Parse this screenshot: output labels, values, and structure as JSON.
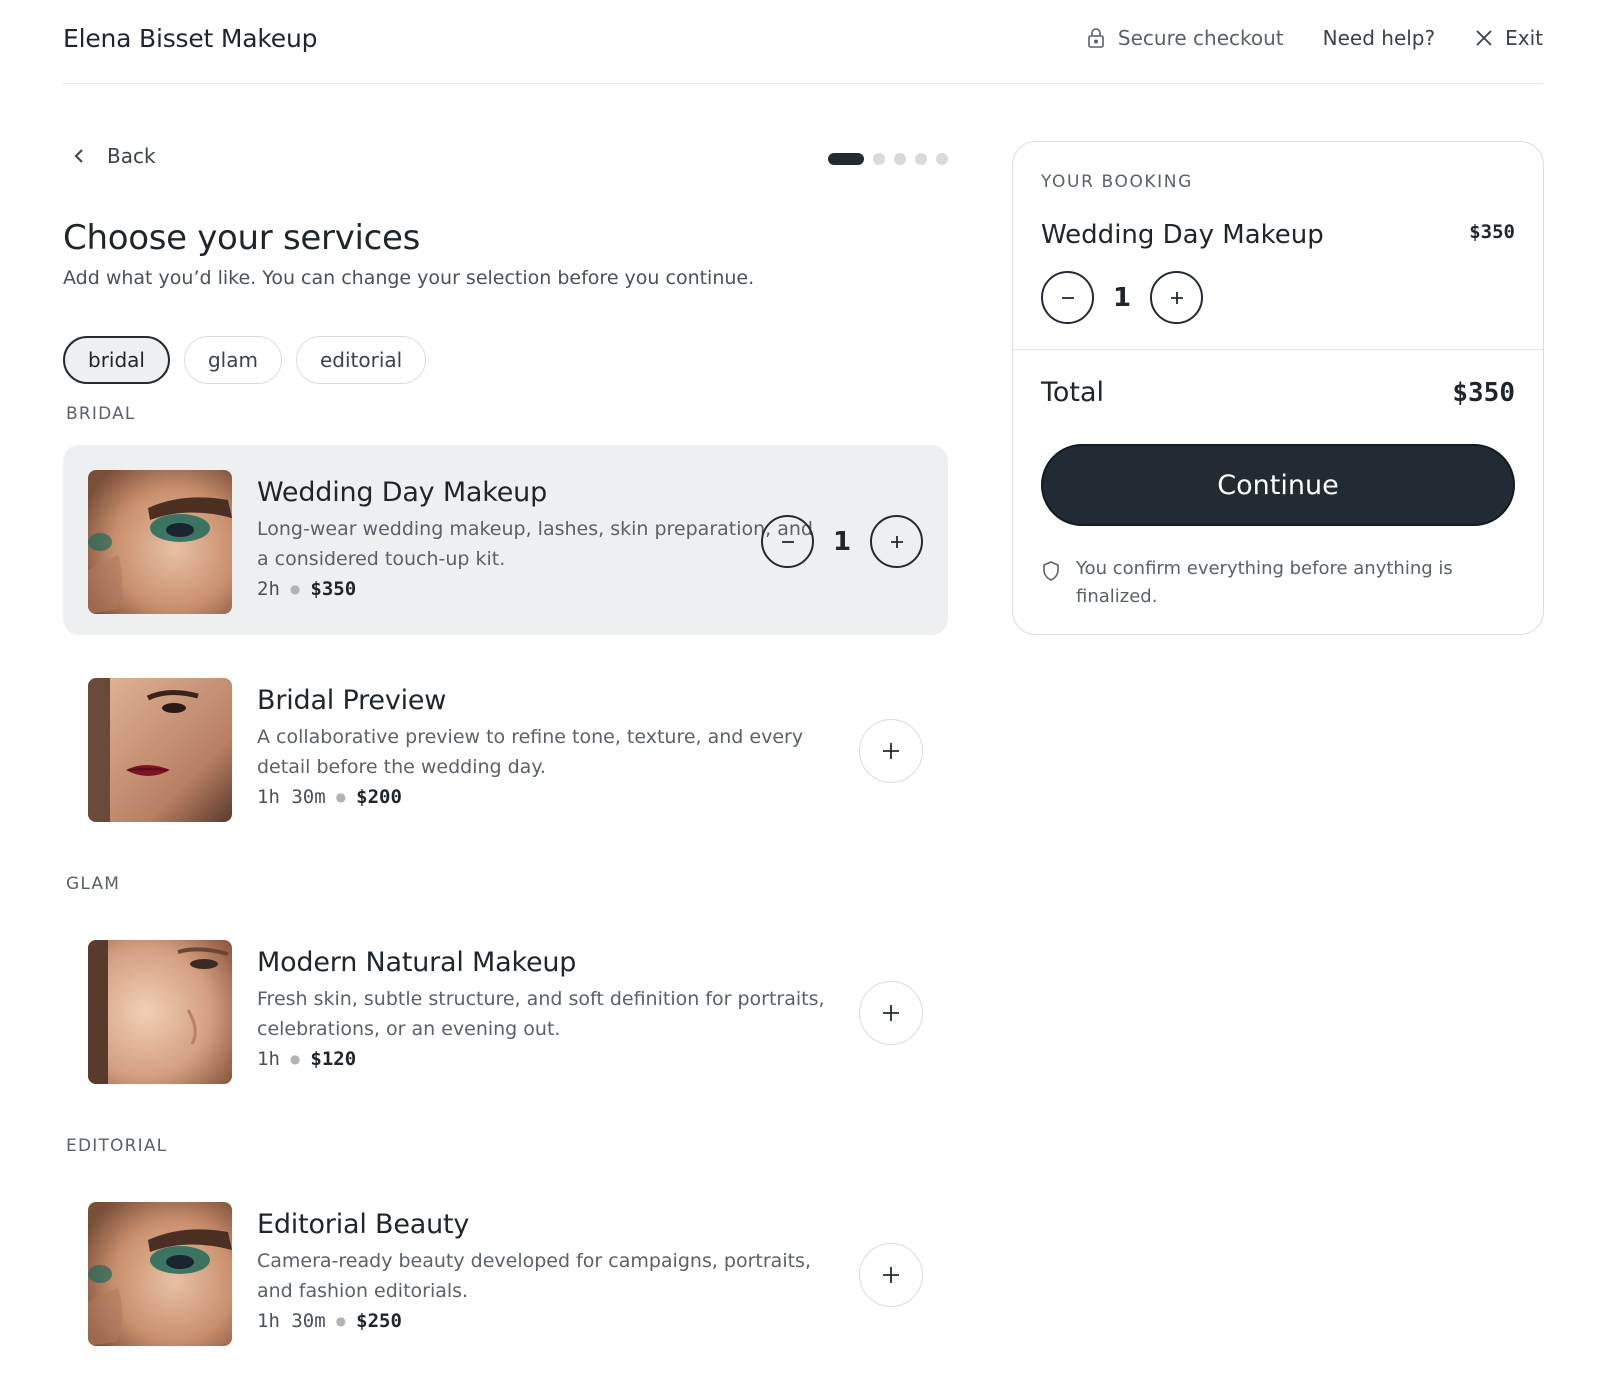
{
  "header": {
    "brand": "Elena Bisset Makeup",
    "secure": "Secure checkout",
    "help": "Need help?",
    "exit": "Exit"
  },
  "nav": {
    "back": "Back",
    "steps_total": 5,
    "step_current": 1
  },
  "page": {
    "title": "Choose your services",
    "subtitle": "Add what you’d like. You can change your selection before you continue."
  },
  "filters": [
    {
      "label": "bridal",
      "active": true
    },
    {
      "label": "glam",
      "active": false
    },
    {
      "label": "editorial",
      "active": false
    }
  ],
  "sections": {
    "bridal": "BRIDAL",
    "glam": "GLAM",
    "editorial": "EDITORIAL"
  },
  "services": [
    {
      "name": "Wedding Day Makeup",
      "desc": "Long-wear wedding makeup, lashes, skin preparation, and a considered touch-up kit.",
      "duration": "2h",
      "price": "$350",
      "qty": "1",
      "selected": true
    },
    {
      "name": "Bridal Preview",
      "desc": "A collaborative preview to refine tone, texture, and every detail before the wedding day.",
      "duration": "1h 30m",
      "price": "$200",
      "selected": false
    },
    {
      "name": "Modern Natural Makeup",
      "desc": "Fresh skin, subtle structure, and soft definition for portraits, celebrations, or an evening out.",
      "duration": "1h",
      "price": "$120",
      "selected": false
    },
    {
      "name": "Editorial Beauty",
      "desc": "Camera-ready beauty developed for campaigns, portraits, and fashion editorials.",
      "duration": "1h 30m",
      "price": "$250",
      "selected": false
    }
  ],
  "booking": {
    "label": "YOUR BOOKING",
    "item_name": "Wedding Day Makeup",
    "item_price": "$350",
    "item_qty": "1",
    "total_label": "Total",
    "total_value": "$350",
    "continue": "Continue",
    "note": "You confirm everything before anything is finalized."
  },
  "colors": {
    "primary": "#222a33",
    "selected_bg": "#eeeff1",
    "border": "#dadcdf",
    "muted_text": "#5a6168"
  },
  "icons": {
    "lock": "lock-icon",
    "close": "close-icon",
    "back": "chevron-left-icon",
    "minus": "minus-icon",
    "plus": "plus-icon",
    "shield": "shield-icon"
  }
}
